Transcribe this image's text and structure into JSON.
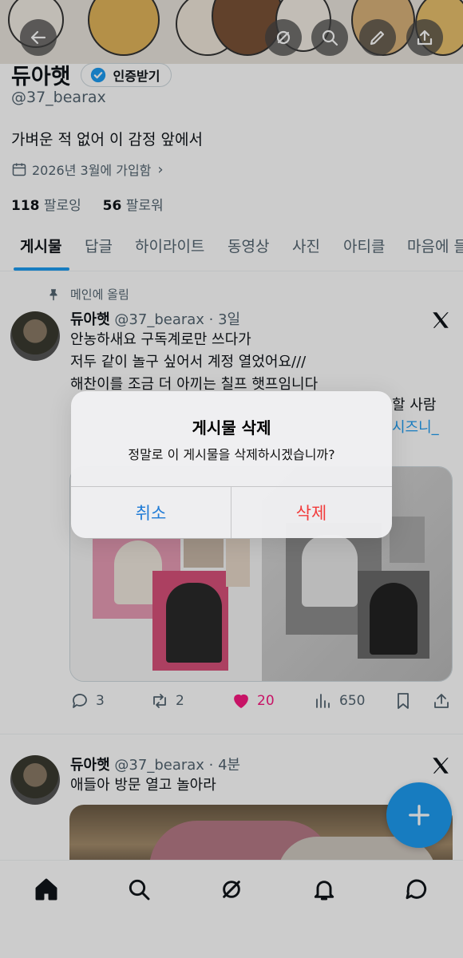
{
  "profile": {
    "name": "듀아햇",
    "verify_label": "인증받기",
    "handle": "@37_bearax",
    "bio": "가벼운 적 없어 이 감정 앞에서",
    "joined": "2026년 3월에 가입함",
    "following_count": "118",
    "following_label": "팔로잉",
    "followers_count": "56",
    "followers_label": "팔로워"
  },
  "tabs": [
    "게시물",
    "답글",
    "하이라이트",
    "동영상",
    "사진",
    "아티클",
    "마음에 들"
  ],
  "pinned_label": "메인에 올림",
  "tweets": [
    {
      "name": "듀아햇",
      "meta": "@37_bearax · 3일",
      "lines": [
        "안농하새요 구독계로만 쓰다가",
        "저두 같이 놀구 싶어서 계정 열었어요///",
        "해찬이를 조금 더 아끼는 칠프 햇프임니다"
      ],
      "line4_fragment": "할 사람",
      "link_fragment": "시즈니_",
      "stats": {
        "replies": "3",
        "reposts": "2",
        "likes": "20",
        "views": "650"
      }
    },
    {
      "name": "듀아햇",
      "meta": "@37_bearax · 4분",
      "lines": [
        "애들아 방문 열고 놀아라"
      ]
    }
  ],
  "dialog": {
    "title": "게시물 삭제",
    "message": "정말로 이 게시물을 삭제하시겠습니까?",
    "cancel": "취소",
    "confirm": "삭제"
  },
  "icons": {
    "header": [
      "back-arrow-icon",
      "grok-icon",
      "search-icon",
      "edit-icon",
      "share-icon"
    ],
    "nav": [
      "home-icon",
      "search-icon",
      "grok-icon",
      "notifications-icon",
      "messages-icon"
    ]
  },
  "colors": {
    "accent": "#1d9bf0",
    "like": "#f91880",
    "delete": "#f23b3b",
    "cancel": "#1f7bd6"
  }
}
